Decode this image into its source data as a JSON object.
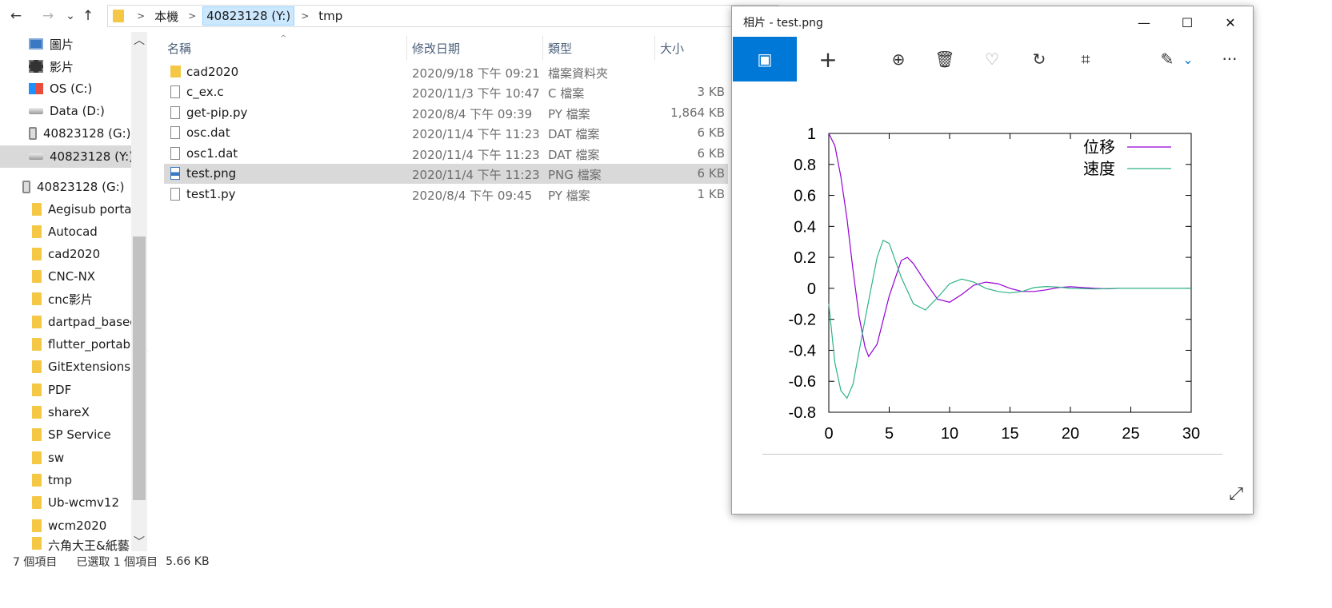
{
  "explorer": {
    "nav": {
      "back_icon": "←",
      "forward_icon": "→",
      "recent_icon": "⌄",
      "up_icon": "↑"
    },
    "address": {
      "crumbs": [
        "本機",
        "40823128 (Y:)",
        "tmp"
      ]
    },
    "sidebar": {
      "items": [
        {
          "label": "圖片",
          "icon": "pictures-icon"
        },
        {
          "label": "影片",
          "icon": "videos-icon"
        },
        {
          "label": "OS (C:)",
          "icon": "os-drive-icon"
        },
        {
          "label": "Data (D:)",
          "icon": "drive-icon"
        },
        {
          "label": "40823128 (G:)",
          "icon": "usb-drive-icon"
        },
        {
          "label": "40823128 (Y:)",
          "icon": "drive-icon"
        },
        {
          "label": "40823128 (G:)",
          "icon": "usb-drive-icon"
        },
        {
          "label": "Aegisub portabl",
          "icon": "folder-icon"
        },
        {
          "label": "Autocad",
          "icon": "folder-icon"
        },
        {
          "label": "cad2020",
          "icon": "folder-icon"
        },
        {
          "label": "CNC-NX",
          "icon": "folder-icon"
        },
        {
          "label": "cnc影片",
          "icon": "folder-icon"
        },
        {
          "label": "dartpad_based",
          "icon": "folder-icon"
        },
        {
          "label": "flutter_portable_",
          "icon": "folder-icon"
        },
        {
          "label": "GitExtensions",
          "icon": "folder-icon"
        },
        {
          "label": "PDF",
          "icon": "folder-icon"
        },
        {
          "label": "shareX",
          "icon": "folder-icon"
        },
        {
          "label": "SP Service",
          "icon": "folder-icon"
        },
        {
          "label": "sw",
          "icon": "folder-icon"
        },
        {
          "label": "tmp",
          "icon": "folder-icon"
        },
        {
          "label": "Ub-wcmv12",
          "icon": "folder-icon"
        },
        {
          "label": "wcm2020",
          "icon": "folder-icon"
        },
        {
          "label": "六角大王&紙藝",
          "icon": "folder-icon"
        }
      ],
      "scroll_up": "︿",
      "scroll_down": "﹀"
    },
    "columns": {
      "name": "名稱",
      "date": "修改日期",
      "type": "類型",
      "size": "大小",
      "sort_indicator": "^"
    },
    "files": [
      {
        "name": "cad2020",
        "date": "2020/9/18 下午 09:21",
        "type": "檔案資料夾",
        "size": "",
        "kind": "folder"
      },
      {
        "name": "c_ex.c",
        "date": "2020/11/3 下午 10:47",
        "type": "C 檔案",
        "size": "3 KB",
        "kind": "file"
      },
      {
        "name": "get-pip.py",
        "date": "2020/8/4 下午 09:39",
        "type": "PY 檔案",
        "size": "1,864 KB",
        "kind": "file"
      },
      {
        "name": "osc.dat",
        "date": "2020/11/4 下午 11:23",
        "type": "DAT 檔案",
        "size": "6 KB",
        "kind": "file"
      },
      {
        "name": "osc1.dat",
        "date": "2020/11/4 下午 11:23",
        "type": "DAT 檔案",
        "size": "6 KB",
        "kind": "file"
      },
      {
        "name": "test.png",
        "date": "2020/11/4 下午 11:23",
        "type": "PNG 檔案",
        "size": "6 KB",
        "kind": "png"
      },
      {
        "name": "test1.py",
        "date": "2020/8/4 下午 09:45",
        "type": "PY 檔案",
        "size": "1 KB",
        "kind": "file"
      }
    ],
    "status": {
      "count": "7 個項目",
      "selection": "已選取 1 個項目",
      "size": "5.66 KB"
    }
  },
  "photos": {
    "title": "相片 - test.png",
    "window": {
      "minimize": "—",
      "maximize": "☐",
      "close": "✕"
    },
    "toolbar": {
      "view": "▣",
      "add": "+",
      "zoom": "⊕",
      "delete": "🗑",
      "favorite": "♡",
      "rotate": "↻",
      "crop": "⌗",
      "edit": "✎",
      "edit_chevron": "⌄",
      "more": "···"
    },
    "expand_icon": "⤢",
    "chart_data": {
      "type": "line",
      "title": "",
      "xlabel": "",
      "ylabel": "",
      "xlim": [
        0,
        30
      ],
      "ylim": [
        -0.8,
        1
      ],
      "xticks": [
        0,
        5,
        10,
        15,
        20,
        25,
        30
      ],
      "yticks": [
        1,
        0.8,
        0.6,
        0.4,
        0.2,
        0,
        -0.2,
        -0.4,
        -0.6,
        -0.8
      ],
      "ytick_labels": [
        "1",
        "0.8",
        "0.6",
        "0.4",
        "0.2",
        "0",
        "-0.2",
        "-0.4",
        "-0.6",
        "-0.8"
      ],
      "legend_position": "top-right",
      "series": [
        {
          "name": "位移",
          "color": "#9400d3",
          "x": [
            0,
            0.5,
            1,
            1.5,
            2,
            2.5,
            3,
            3.3,
            4,
            5,
            6,
            6.5,
            7,
            8,
            9,
            10,
            11,
            12,
            13,
            14,
            15,
            16,
            17,
            18,
            19,
            20,
            21,
            22,
            23,
            24
          ],
          "y": [
            1,
            0.92,
            0.72,
            0.45,
            0.12,
            -0.18,
            -0.38,
            -0.44,
            -0.36,
            -0.05,
            0.18,
            0.2,
            0.16,
            0.04,
            -0.07,
            -0.09,
            -0.04,
            0.02,
            0.04,
            0.03,
            0.0,
            -0.02,
            -0.02,
            -0.01,
            0.005,
            0.01,
            0.005,
            0.0,
            -0.003,
            0.0
          ]
        },
        {
          "name": "速度",
          "color": "#2db383",
          "x": [
            0,
            0.5,
            1,
            1.5,
            2,
            3,
            4,
            4.5,
            5,
            6,
            7,
            8,
            9,
            10,
            11,
            12,
            13,
            14,
            15,
            16,
            17,
            18,
            19,
            20,
            22,
            24,
            26,
            28,
            30
          ],
          "y": [
            -0.1,
            -0.48,
            -0.66,
            -0.71,
            -0.62,
            -0.2,
            0.2,
            0.31,
            0.29,
            0.07,
            -0.1,
            -0.14,
            -0.06,
            0.03,
            0.06,
            0.04,
            0.0,
            -0.02,
            -0.03,
            -0.02,
            0.005,
            0.012,
            0.008,
            0.0,
            -0.004,
            0.0,
            0.0,
            0.0,
            0.0
          ]
        }
      ]
    }
  }
}
